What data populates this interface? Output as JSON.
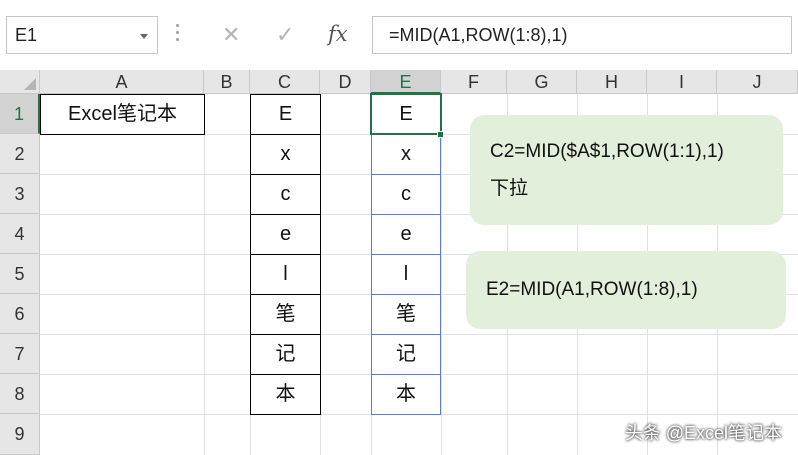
{
  "formula_bar": {
    "name_box": "E1",
    "cancel_icon": "✕",
    "enter_icon": "✓",
    "fx_label": "fx",
    "formula": "=MID(A1,ROW(1:8),1)"
  },
  "columns": [
    "A",
    "B",
    "C",
    "D",
    "E",
    "F",
    "G",
    "H",
    "I",
    "J"
  ],
  "selected_column": "E",
  "rows": [
    "1",
    "2",
    "3",
    "4",
    "5",
    "6",
    "7",
    "8",
    "9"
  ],
  "selected_row": "1",
  "cells": {
    "A1": "Excel笔记本",
    "C": [
      "E",
      "x",
      "c",
      "e",
      "l",
      "笔",
      "记",
      "本"
    ],
    "E": [
      "E",
      "x",
      "c",
      "e",
      "l",
      "笔",
      "记",
      "本"
    ]
  },
  "notes": [
    {
      "lines": [
        "C2=MID($A$1,ROW(1:1),1)",
        "下拉"
      ]
    },
    {
      "lines": [
        "E2=MID(A1,ROW(1:8),1)"
      ]
    }
  ],
  "watermark": "头条 @Excel笔记本",
  "colors": {
    "accent": "#217346",
    "note_bg": "#e2efda",
    "selection_blue": "#5b7fc7"
  }
}
